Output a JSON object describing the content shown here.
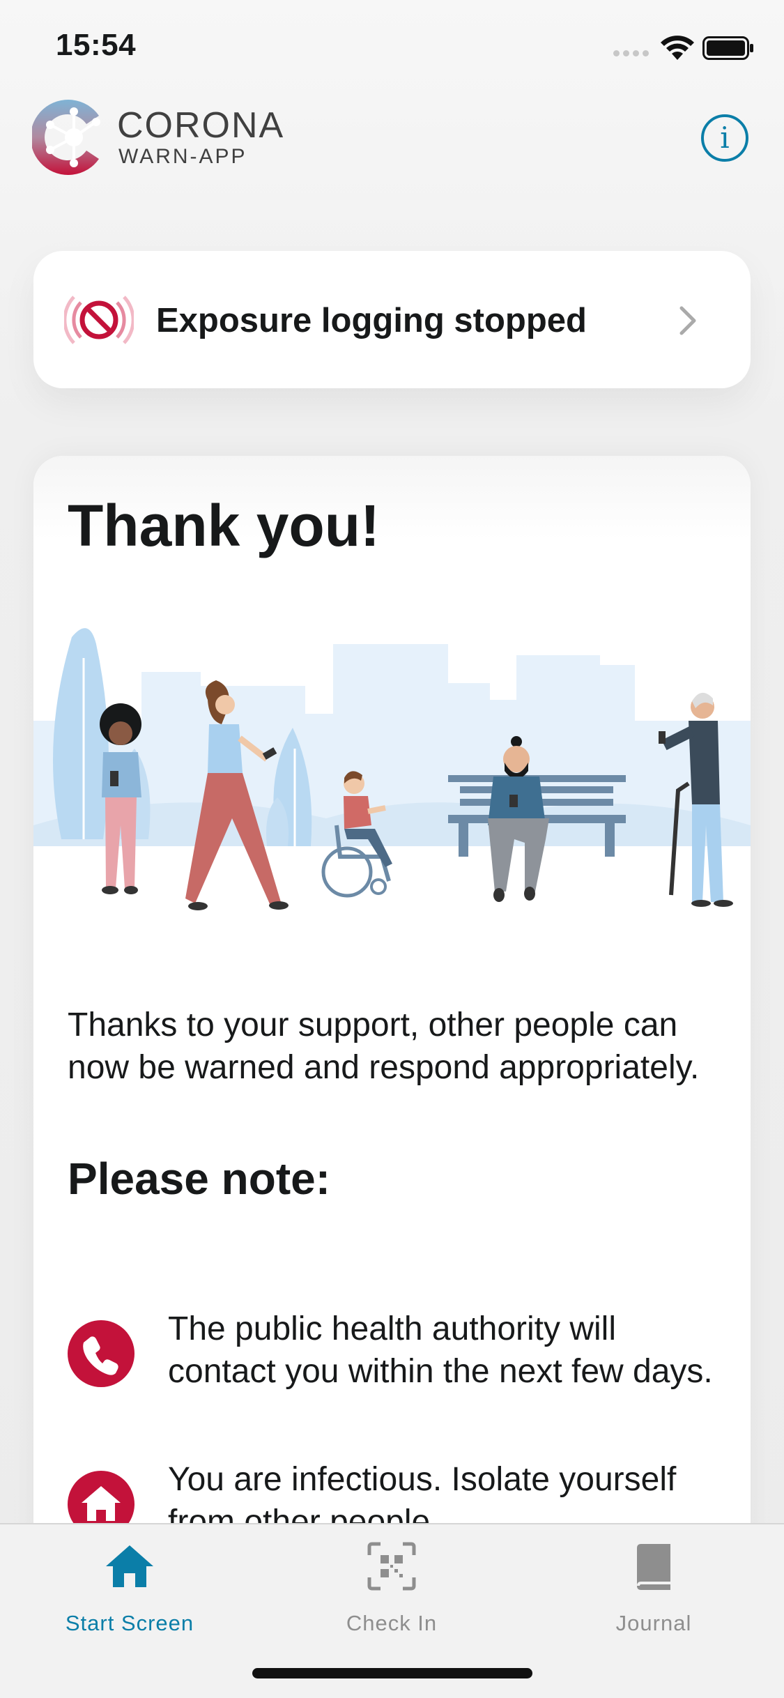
{
  "status_bar": {
    "time": "15:54"
  },
  "header": {
    "brand_title": "CORONA",
    "brand_subtitle": "WARN-APP",
    "info_icon": "info-icon"
  },
  "exposure": {
    "label": "Exposure logging stopped",
    "icon": "exposure-stopped-icon"
  },
  "main": {
    "title": "Thank you!",
    "description": "Thanks to your support, other people can now be warned and respond appropriately.",
    "note_title": "Please note:",
    "notes": [
      {
        "icon": "phone-icon",
        "text": "The public health authority will contact you within the next few days."
      },
      {
        "icon": "home-icon",
        "text": "You are infectious. Isolate yourself from other people."
      }
    ]
  },
  "tab_bar": {
    "tabs": [
      {
        "label": "Start Screen",
        "icon": "home-icon",
        "active": true
      },
      {
        "label": "Check In",
        "icon": "qr-code-icon",
        "active": false
      },
      {
        "label": "Journal",
        "icon": "book-icon",
        "active": false
      }
    ]
  },
  "colors": {
    "accent": "#0b7ea8",
    "alert": "#c3123a",
    "inactive": "#8e8e8e"
  }
}
